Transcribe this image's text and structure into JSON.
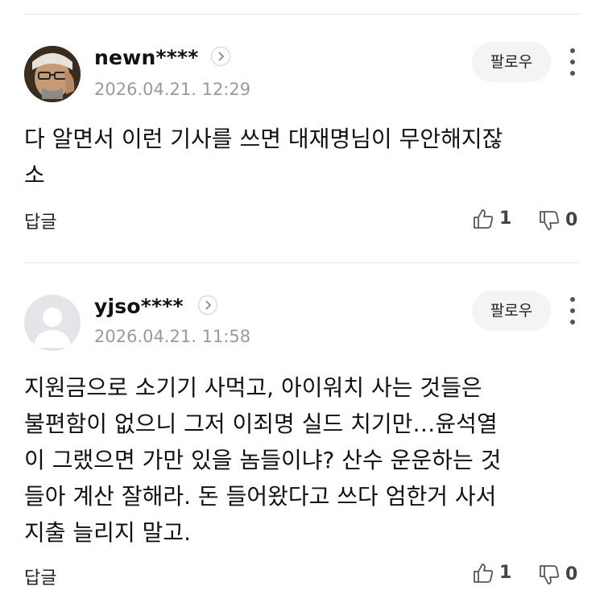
{
  "comments": [
    {
      "username": "newn****",
      "date": "2026.04.21. 12:29",
      "follow_label": "팔로우",
      "text": "다 알면서 이런 기사를 쓰면 대재명님이 무안해지잖\n소",
      "reply_label": "답글",
      "likes": "1",
      "dislikes": "0"
    },
    {
      "username": "yjso****",
      "date": "2026.04.21. 11:58",
      "follow_label": "팔로우",
      "text": "지원금으로 소기기 사먹고, 아이워치 사는 것들은\n불편함이 없으니 그저 이죄명 실드 치기만…윤석열\n이 그랬으면 가만 있을 놈들이냐? 산수 운운하는 것\n들아 계산 잘해라. 돈 들어왔다고 쓰다 엄한거 사서\n지출 늘리지 말고.",
      "reply_label": "답글",
      "likes": "1",
      "dislikes": "0"
    }
  ]
}
